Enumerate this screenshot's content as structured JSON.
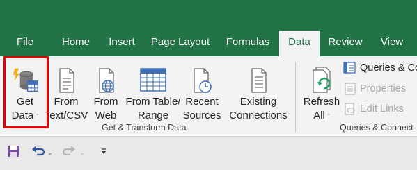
{
  "tabs": [
    {
      "label": "File"
    },
    {
      "label": "Home"
    },
    {
      "label": "Insert"
    },
    {
      "label": "Page Layout"
    },
    {
      "label": "Formulas"
    },
    {
      "label": "Data"
    },
    {
      "label": "Review"
    },
    {
      "label": "View"
    }
  ],
  "active_tab": "Data",
  "colors": {
    "menubar": "#217346",
    "ribbon": "#f3f3f3",
    "highlight": "#e60000"
  },
  "ribbon": {
    "get_transform": {
      "get_data": {
        "line1": "Get",
        "line2": "Data",
        "chevron": "ˇ",
        "icon": "database-lightning-icon"
      },
      "from_text_csv": {
        "line1": "From",
        "line2": "Text/CSV",
        "icon": "text-file-icon"
      },
      "from_web": {
        "line1": "From",
        "line2": "Web",
        "icon": "web-file-icon"
      },
      "from_table_range": {
        "line1": "From Table/",
        "line2": "Range",
        "icon": "table-icon"
      },
      "recent_sources": {
        "line1": "Recent",
        "line2": "Sources",
        "icon": "clock-file-icon"
      },
      "existing_connections": {
        "line1": "Existing",
        "line2": "Connections",
        "icon": "connections-file-icon"
      },
      "group_label": "Get & Transform Data"
    },
    "queries_connections": {
      "refresh_all": {
        "line1": "Refresh",
        "line2": "All",
        "chevron": "ˇ",
        "icon": "refresh-icon"
      },
      "queries_connections": {
        "label": "Queries & Co",
        "icon": "queries-icon"
      },
      "properties": {
        "label": "Properties",
        "icon": "properties-icon"
      },
      "edit_links": {
        "label": "Edit Links",
        "icon": "edit-links-icon"
      },
      "group_label": "Queries & Connect"
    }
  },
  "qat": {
    "save_icon": "save-icon",
    "undo_icon": "undo-icon",
    "redo_icon": "redo-icon",
    "customize_icon": "customize-qat-icon"
  }
}
